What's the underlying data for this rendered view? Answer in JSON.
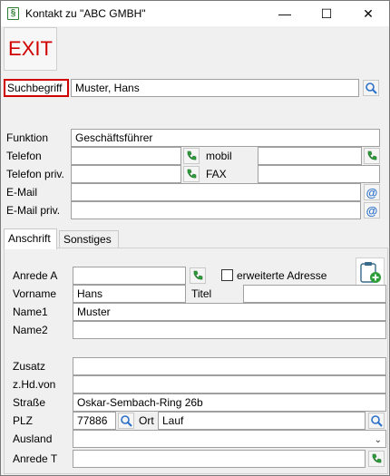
{
  "window": {
    "title": "Kontakt zu \"ABC GMBH\"",
    "controls": {
      "minimize": "—",
      "maximize": "☐",
      "close": "✕"
    }
  },
  "toolbar": {
    "exit_label": "EXIT"
  },
  "search": {
    "label": "Suchbegriff",
    "value": "Muster, Hans"
  },
  "contact": {
    "funktion_label": "Funktion",
    "funktion_value": "Geschäftsführer",
    "telefon_label": "Telefon",
    "telefon_value": "",
    "mobil_label": "mobil",
    "mobil_value": "",
    "telefon_priv_label": "Telefon priv.",
    "telefon_priv_value": "",
    "fax_label": "FAX",
    "fax_value": "",
    "email_label": "E-Mail",
    "email_value": "",
    "email_priv_label": "E-Mail priv.",
    "email_priv_value": ""
  },
  "tabs": [
    {
      "label": "Anschrift",
      "active": true
    },
    {
      "label": "Sonstiges",
      "active": false
    }
  ],
  "address": {
    "anrede_a_label": "Anrede A",
    "anrede_a_value": "",
    "erweiterte_label": "erweiterte Adresse",
    "erweiterte_checked": false,
    "vorname_label": "Vorname",
    "vorname_value": "Hans",
    "titel_label": "Titel",
    "titel_value": "",
    "name1_label": "Name1",
    "name1_value": "Muster",
    "name2_label": "Name2",
    "name2_value": "",
    "zusatz_label": "Zusatz",
    "zusatz_value": "",
    "zhdvon_label": "z.Hd.von",
    "zhdvon_value": "",
    "strasse_label": "Straße",
    "strasse_value": "Oskar-Sembach-Ring 26b",
    "plz_label": "PLZ",
    "plz_value": "77886",
    "ort_label": "Ort",
    "ort_value": "Lauf",
    "ausland_label": "Ausland",
    "ausland_value": "",
    "anrede_t_label": "Anrede T",
    "anrede_t_value": ""
  },
  "icons": {
    "search": "magnifier-icon",
    "phone": "phone-icon",
    "email": "at-icon",
    "clipboard": "clipboard-add-icon"
  },
  "colors": {
    "exit_text": "#d00000",
    "highlight_border": "#d00000",
    "accent_green": "#2e9e3a",
    "search_blue": "#2a6fc9"
  }
}
